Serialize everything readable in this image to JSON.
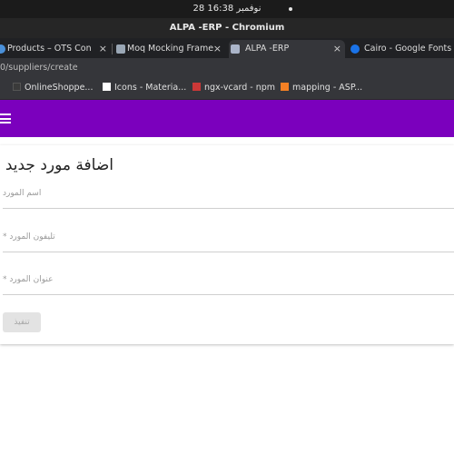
{
  "os_bar": {
    "clock": "28 نوفمبر  16:38"
  },
  "window": {
    "title": "ALPA -ERP - Chromium"
  },
  "tabs": [
    {
      "label": "Products – OTS Con",
      "icon": "web-page-icon",
      "color": "#4a90d9"
    },
    {
      "label": "Moq Mocking Frame",
      "icon": "moq-icon",
      "color": "#9aa7b5"
    },
    {
      "label": "ALPA -ERP",
      "icon": "page-icon",
      "color": "#aab4c8",
      "active": true
    },
    {
      "label": "Cairo - Google Fonts",
      "icon": "google-fonts-icon",
      "color": "#1a73e8"
    }
  ],
  "tab_close_glyph": "×",
  "address_bar": {
    "url": "0/suppliers/create"
  },
  "bookmarks": [
    {
      "label": "OnlineShoppe...",
      "icon": "folder-icon",
      "color": "#3a3a3a"
    },
    {
      "label": "Icons - Materia...",
      "icon": "bookmark-icon",
      "color": "#ffffff"
    },
    {
      "label": "ngx-vcard - npm",
      "icon": "npm-icon",
      "color": "#cb3837"
    },
    {
      "label": "mapping - ASP...",
      "icon": "stackoverflow-icon",
      "color": "#f48024"
    }
  ],
  "app": {
    "header_color": "#7b00bd"
  },
  "form": {
    "title": "اضافة مورد جديد",
    "fields": [
      {
        "label": "اسم المورد"
      },
      {
        "label": "تليفون المورد *"
      },
      {
        "label": "عنوان المورد *"
      }
    ],
    "submit_label": "تنفيذ"
  }
}
